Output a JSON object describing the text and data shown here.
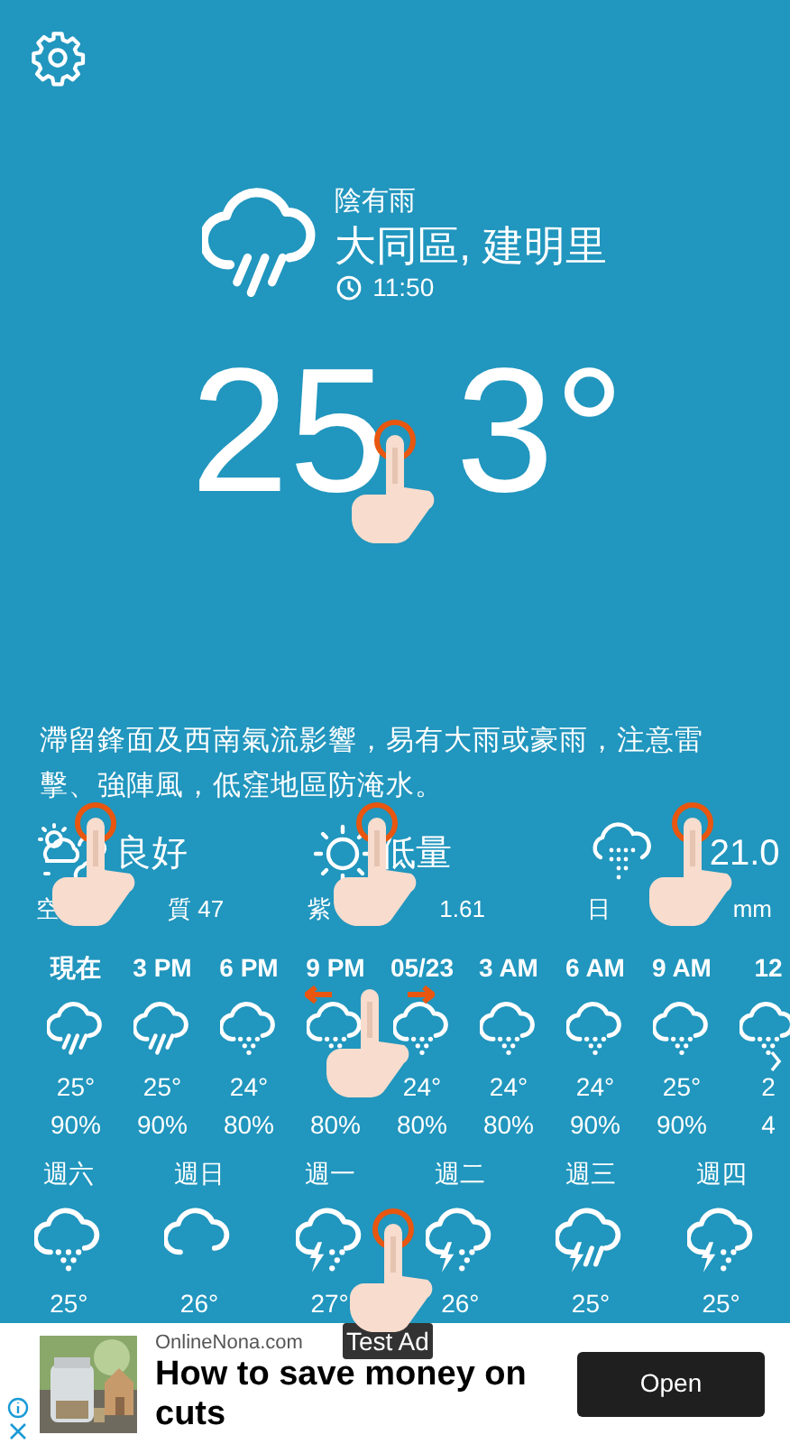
{
  "current": {
    "condition": "陰有雨",
    "location": "大同區, 建明里",
    "time": "11:50",
    "temperature_parts": [
      "25",
      "3°"
    ],
    "kind": "rain"
  },
  "description": "滯留鋒面及西南氣流影響，易有大雨或豪雨，注意雷擊、強陣風，低窪地區防淹水。",
  "stats": [
    {
      "kind": "air",
      "value": "良好",
      "label_parts": [
        "空",
        "質 47"
      ]
    },
    {
      "kind": "uv",
      "value": "低量",
      "label_parts": [
        "紫",
        "1.61"
      ]
    },
    {
      "kind": "rainfall",
      "value": "21.0",
      "label_parts": [
        "日",
        "mm"
      ]
    }
  ],
  "hourly": [
    {
      "time": "現在",
      "kind": "rain",
      "temp": "25°",
      "humidity": "90%"
    },
    {
      "time": "3 PM",
      "kind": "rain",
      "temp": "25°",
      "humidity": "90%"
    },
    {
      "time": "6 PM",
      "kind": "showers",
      "temp": "24°",
      "humidity": "80%"
    },
    {
      "time": "9 PM",
      "kind": "showers",
      "humidity": "80%"
    },
    {
      "time": "05/23",
      "kind": "showers",
      "temp": "24°",
      "humidity": "80%"
    },
    {
      "time": "3 AM",
      "kind": "showers",
      "temp": "24°",
      "humidity": "80%"
    },
    {
      "time": "6 AM",
      "kind": "showers",
      "temp": "24°",
      "humidity": "90%"
    },
    {
      "time": "9 AM",
      "kind": "showers",
      "temp": "25°",
      "humidity": "90%"
    },
    {
      "time": "12",
      "kind": "showers",
      "temp": "2",
      "humidity": "4"
    }
  ],
  "daily": [
    {
      "day": "週六",
      "kind": "showers",
      "temp": "25°"
    },
    {
      "day": "週日",
      "kind": "cloud",
      "temp": "26°"
    },
    {
      "day": "週一",
      "kind": "thunder",
      "temp": "27°"
    },
    {
      "day": "週二",
      "kind": "thunder",
      "temp": "26°"
    },
    {
      "day": "週三",
      "kind": "thunder_rain",
      "temp": "25°"
    },
    {
      "day": "週四",
      "kind": "thunder",
      "temp": "25°"
    }
  ],
  "ad": {
    "label": "Test Ad",
    "source": "OnlineNona.com",
    "headline": "How to save money on cuts",
    "button": "Open"
  }
}
